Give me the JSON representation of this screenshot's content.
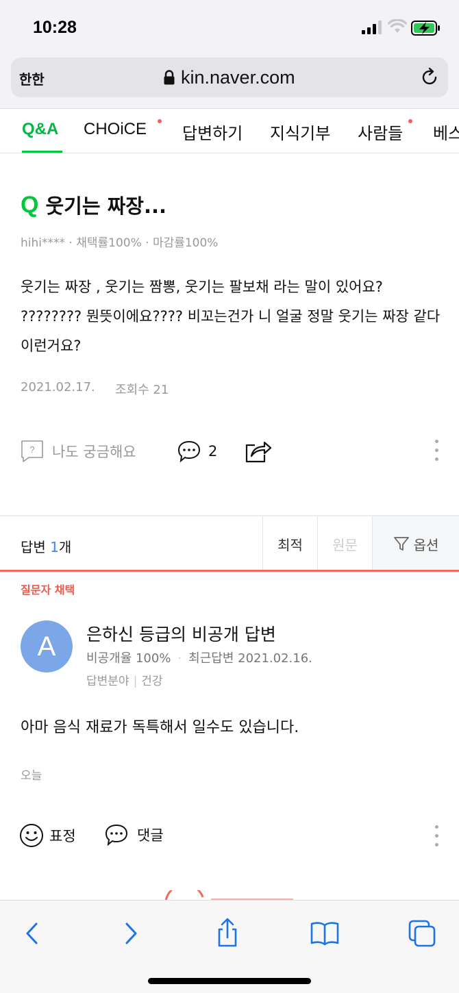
{
  "status": {
    "time": "10:28"
  },
  "browser": {
    "aa_label": "한한",
    "url": "kin.naver.com",
    "toolbar_icons": [
      "back-icon",
      "forward-icon",
      "share-icon",
      "bookmarks-icon",
      "tabs-icon"
    ]
  },
  "nav": {
    "tabs": [
      {
        "label": "Q&A"
      },
      {
        "label": "CHOiCE"
      },
      {
        "label": "답변하기"
      },
      {
        "label": "지식기부"
      },
      {
        "label": "사람들"
      },
      {
        "label": "베스"
      }
    ]
  },
  "question": {
    "mark": "Q",
    "title": "웃기는 짜장...",
    "meta": "hihi**** · 채택률100% · 마감률100%",
    "body": "웃기는 짜장 , 웃기는 짬뽕, 웃기는 팔보채 라는 말이 있어요? ???????? 뭔뜻이에요???? 비꼬는건가 니 얼굴 정말 웃기는 짜장 같다 이런거요?",
    "date": "2021.02.17.",
    "views": "조회수 21",
    "curious_label": "나도 궁금해요",
    "comment_count": "2"
  },
  "answers_header": {
    "label": "답변",
    "count": "1",
    "unit": "개",
    "sort_best": "최적",
    "sort_original": "원문",
    "options": "옵션"
  },
  "answer": {
    "chosen_label": "질문자 채택",
    "avatar_letter": "A",
    "author": "은하신 등급의 비공개 답변",
    "private_rate": "비공개율 100%",
    "recent": "최근답변 2021.02.16.",
    "field_label": "답변분야",
    "field_value": "건강",
    "body": "아마 음식 재료가 독특해서 일수도 있습니다.",
    "date": "오늘",
    "emote_label": "표정",
    "reply_label": "댓글"
  },
  "colors": {
    "accent_green": "#00c73c",
    "chosen_red": "#ef5a4a",
    "avatar_blue": "#7ba7e8",
    "link_blue": "#3a86ff"
  }
}
